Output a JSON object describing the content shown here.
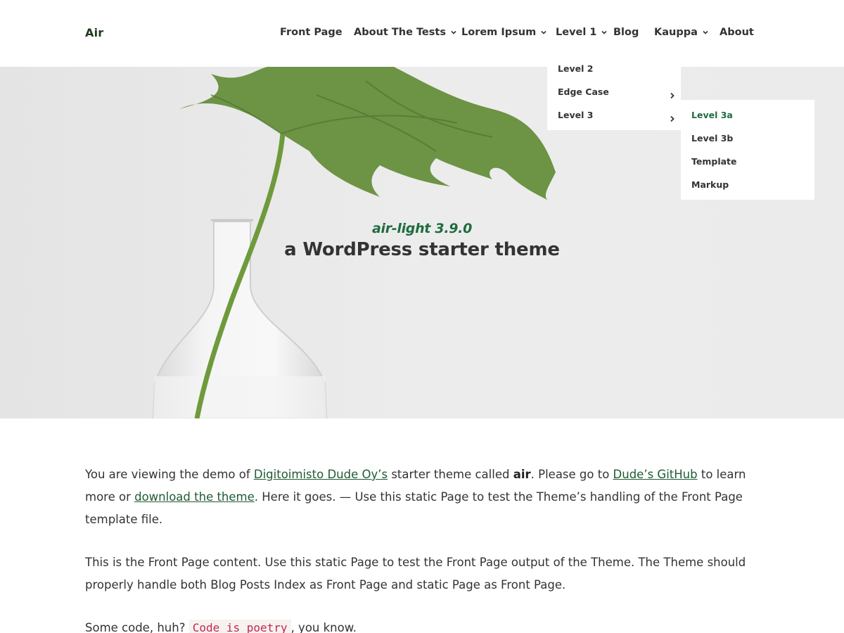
{
  "header": {
    "site_title": "Air",
    "nav": [
      {
        "label": "Front Page",
        "has_submenu": false
      },
      {
        "label": "About The Tests",
        "has_submenu": true
      },
      {
        "label": "Lorem Ipsum",
        "has_submenu": true
      },
      {
        "label": "Level 1",
        "has_submenu": true
      },
      {
        "label": "Blog",
        "has_submenu": false
      },
      {
        "label": "Kauppa",
        "has_submenu": true
      },
      {
        "label": "About",
        "has_submenu": false
      }
    ]
  },
  "dropdown_level1": {
    "items": [
      {
        "label": "Level 2",
        "has_submenu": false
      },
      {
        "label": "Edge Case",
        "has_submenu": true
      },
      {
        "label": "Level 3",
        "has_submenu": true
      }
    ]
  },
  "dropdown_level3": {
    "items": [
      {
        "label": "Level 3a",
        "active": true
      },
      {
        "label": "Level 3b",
        "active": false
      },
      {
        "label": "Template",
        "active": false
      },
      {
        "label": "Markup",
        "active": false
      }
    ]
  },
  "hero": {
    "version": "air-light 3.9.0",
    "tagline": "a WordPress starter theme"
  },
  "content": {
    "p1": {
      "t1": "You are viewing the demo of ",
      "link1": "Digitoimisto Dude Oy’s",
      "t2": " starter theme called ",
      "bold": "air",
      "t3": ". Please go to ",
      "link2": "Dude’s GitHub",
      "t4": " to learn more or ",
      "link3": "download the theme",
      "t5": ". Here it goes. — Use this static Page to test the Theme’s handling of the Front Page template file."
    },
    "p2": "This is the Front Page content. Use this static Page to test the Front Page output of the Theme. The Theme should properly handle both Blog Posts Index as Front Page and static Page as Front Page.",
    "p3": {
      "t1": "Some code, huh? ",
      "code": "Code is poetry",
      "t2": ", you know."
    }
  },
  "colors": {
    "accent": "#1f6b3f",
    "link": "#1f5a32",
    "code": "#c7254e",
    "hero_bg": "#ebebeb"
  },
  "icons": [
    "chevron-down-icon",
    "chevron-right-icon"
  ]
}
